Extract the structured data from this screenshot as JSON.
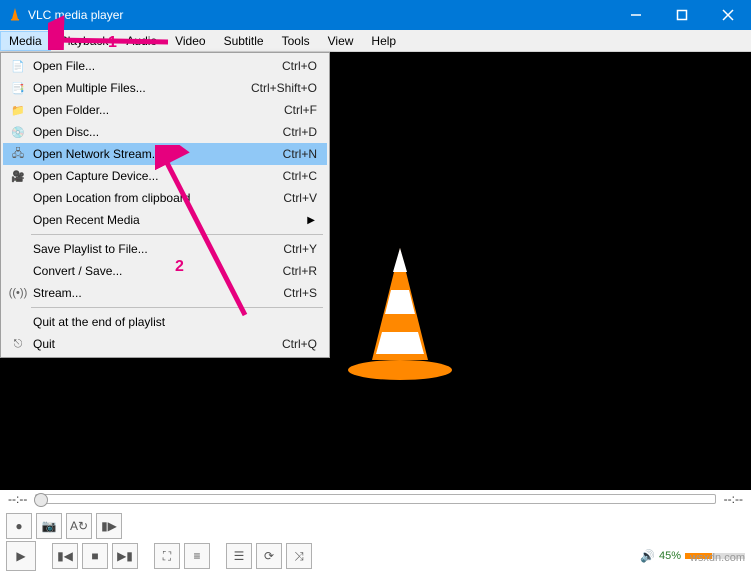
{
  "titlebar": {
    "title": "VLC media player"
  },
  "menubar": {
    "items": [
      "Media",
      "Playback",
      "Audio",
      "Video",
      "Subtitle",
      "Tools",
      "View",
      "Help"
    ]
  },
  "dropdown": {
    "items": [
      {
        "icon": "📄",
        "label": "Open File...",
        "shortcut": "Ctrl+O"
      },
      {
        "icon": "📑",
        "label": "Open Multiple Files...",
        "shortcut": "Ctrl+Shift+O"
      },
      {
        "icon": "📁",
        "label": "Open Folder...",
        "shortcut": "Ctrl+F"
      },
      {
        "icon": "💿",
        "label": "Open Disc...",
        "shortcut": "Ctrl+D"
      },
      {
        "icon": "🖧",
        "label": "Open Network Stream...",
        "shortcut": "Ctrl+N",
        "highlight": true
      },
      {
        "icon": "🎥",
        "label": "Open Capture Device...",
        "shortcut": "Ctrl+C"
      },
      {
        "icon": "",
        "label": "Open Location from clipboard",
        "shortcut": "Ctrl+V"
      },
      {
        "icon": "",
        "label": "Open Recent Media",
        "submenu": true
      },
      {
        "sep": true
      },
      {
        "icon": "",
        "label": "Save Playlist to File...",
        "shortcut": "Ctrl+Y"
      },
      {
        "icon": "",
        "label": "Convert / Save...",
        "shortcut": "Ctrl+R"
      },
      {
        "icon": "((•))",
        "label": "Stream...",
        "shortcut": "Ctrl+S"
      },
      {
        "sep": true
      },
      {
        "icon": "",
        "label": "Quit at the end of playlist",
        "shortcut": ""
      },
      {
        "icon": "⎋",
        "label": "Quit",
        "shortcut": "Ctrl+Q"
      }
    ]
  },
  "time": {
    "left": "--:--",
    "right": "--:--"
  },
  "volume": {
    "pct": "45%"
  },
  "annotations": {
    "n1": "1",
    "n2": "2"
  },
  "watermark": "wsxdn.com"
}
